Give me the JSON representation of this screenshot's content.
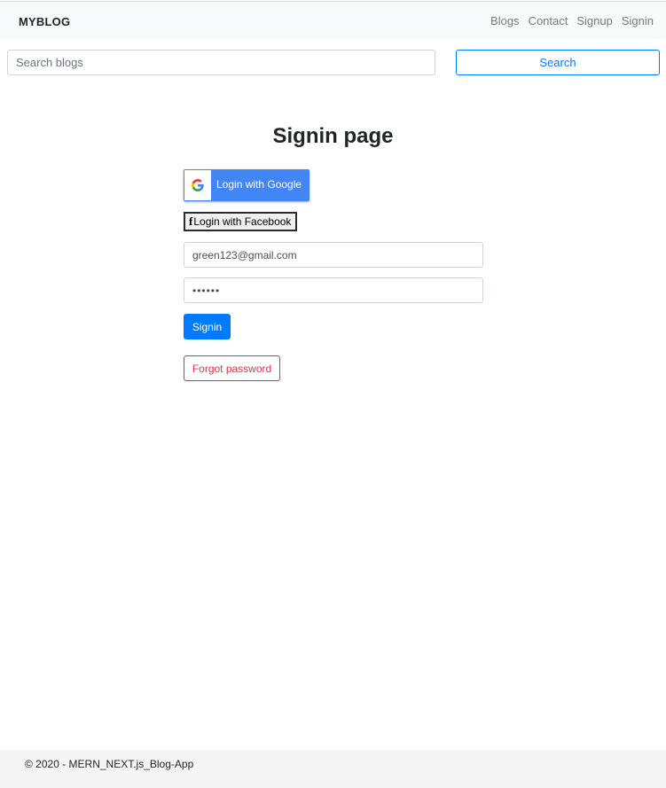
{
  "navbar": {
    "brand": "MYBLOG",
    "links": [
      "Blogs",
      "Contact",
      "Signup",
      "Signin"
    ]
  },
  "search": {
    "placeholder": "Search blogs",
    "button_label": "Search"
  },
  "signin": {
    "title": "Signin page",
    "google_label": "Login with Google",
    "facebook_label": "Login with Facebook",
    "email_value": "green123@gmail.com",
    "password_value": "••••••",
    "signin_label": "Signin",
    "forgot_label": "Forgot password"
  },
  "footer": {
    "text": "© 2020 - MERN_NEXT.js_Blog-App"
  },
  "icons": {
    "google": "google-icon",
    "facebook": "facebook-icon"
  },
  "colors": {
    "primary": "#007bff",
    "danger": "#dc3545",
    "google_blue": "#4285f4",
    "navbar_bg": "#f8f9fa"
  }
}
